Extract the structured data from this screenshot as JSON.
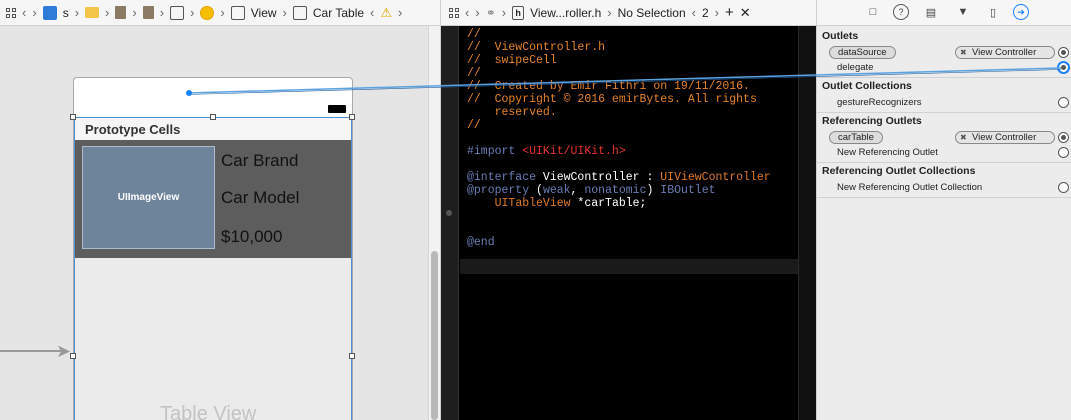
{
  "ib": {
    "jump": [
      "s",
      "View",
      "Car Table"
    ],
    "prototype_cells": "Prototype Cells",
    "image_view": "UIImageView",
    "car_brand": "Car Brand",
    "car_model": "Car Model",
    "price": "$10,000",
    "table_view": "Table View"
  },
  "editor": {
    "file": "View...roller.h",
    "selection": "No Selection",
    "counterparts": "2",
    "code": {
      "l1": "//",
      "l2": "//  ViewController.h",
      "l3": "//  swipeCell",
      "l4": "//",
      "l5": "//  Created by Emir Fithri on 19/11/2016.",
      "l6": "//  Copyright © 2016 emirBytes. All rights",
      "l7": "    reserved.",
      "l8": "//",
      "import_kw": "#import",
      "import_path": "<UIKit/UIKit.h>",
      "interface_kw": "@interface",
      "interface_name": "ViewController",
      "interface_colon": " : ",
      "interface_super": "UIViewController",
      "property_kw": "@property",
      "property_open": " (",
      "property_weak": "weak",
      "property_comma": ", ",
      "property_nonatomic": "nonatomic",
      "property_close": ") ",
      "property_iboutlet": "IBOutlet",
      "property_type": "UITableView",
      "property_var": " *carTable;",
      "end_kw": "@end"
    }
  },
  "inspector": {
    "outlets_title": "Outlets",
    "outlets": [
      {
        "name": "dataSource",
        "target": "View Controller",
        "connected": true
      },
      {
        "name": "delegate",
        "target": "",
        "connected": true
      }
    ],
    "outlet_collections_title": "Outlet Collections",
    "outlet_collections": [
      {
        "name": "gestureRecognizers",
        "connected": false
      }
    ],
    "referencing_outlets_title": "Referencing Outlets",
    "referencing_outlets": [
      {
        "name": "carTable",
        "target": "View Controller",
        "connected": true
      },
      {
        "name": "New Referencing Outlet",
        "connected": false
      }
    ],
    "referencing_collections_title": "Referencing Outlet Collections",
    "referencing_collections": [
      {
        "name": "New Referencing Outlet Collection",
        "connected": false
      }
    ]
  },
  "colors": {
    "accent": "#1a82fb",
    "comment": "#e5832a",
    "keyword": "#c2349b",
    "string": "#e5332a",
    "cell_bg": "#5d5d5d",
    "imageview_bg": "#6e849b"
  }
}
